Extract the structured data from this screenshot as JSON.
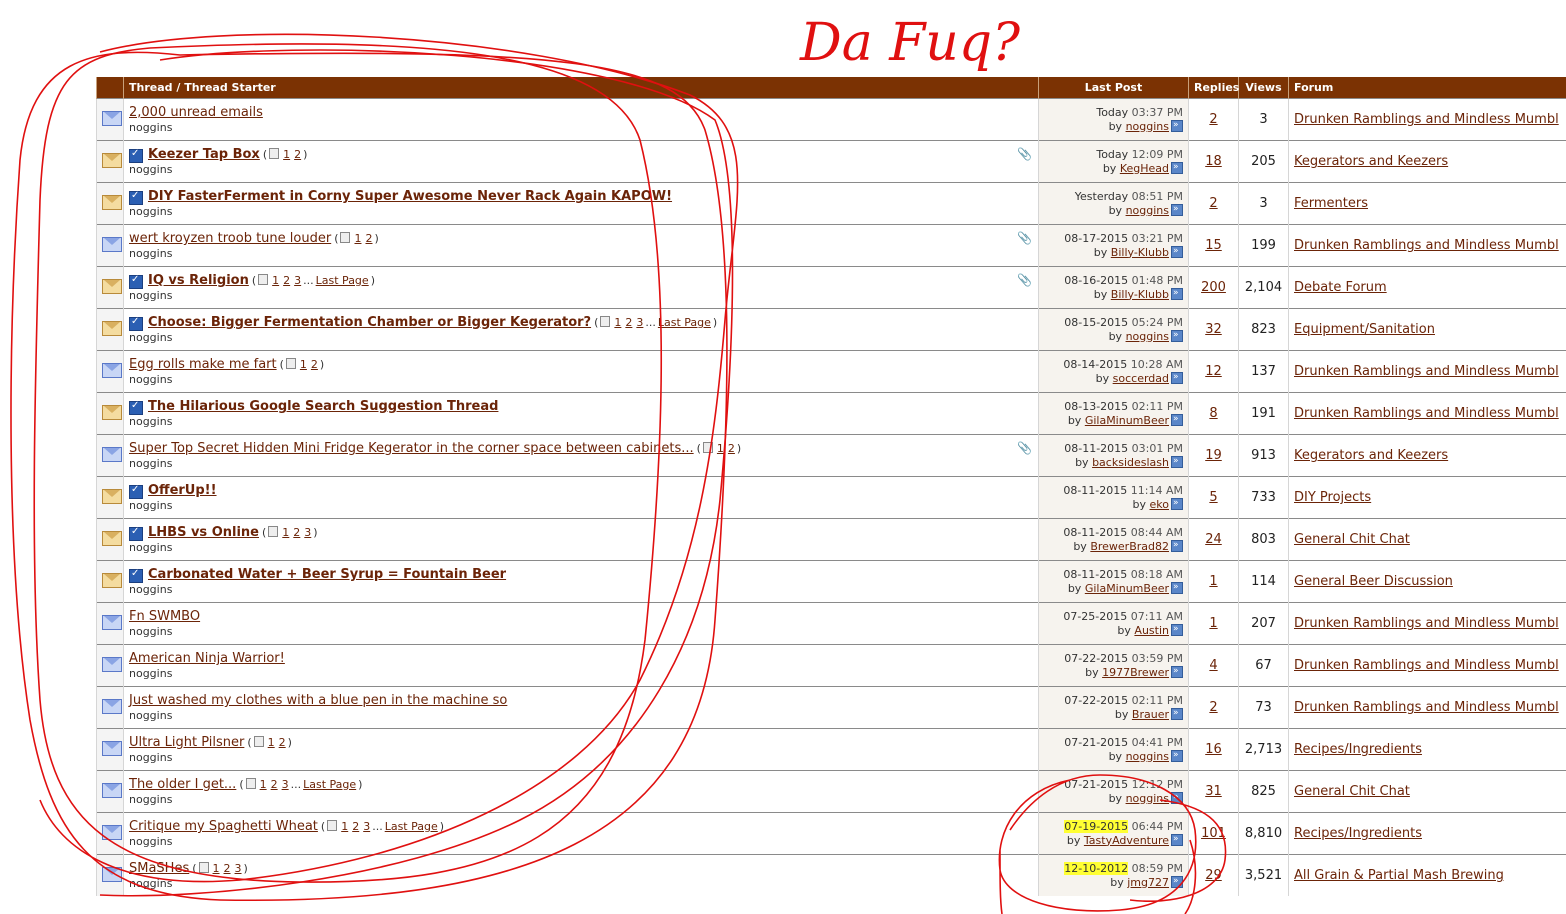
{
  "annotation_text": "Da Fuq?",
  "headers": {
    "thread": "Thread / Thread Starter",
    "last_post": "Last Post",
    "replies": "Replies",
    "views": "Views",
    "forum": "Forum"
  },
  "colors": {
    "header_bg": "#7b3203",
    "link": "#6b2408",
    "highlight": "#ffff33",
    "annotation": "#e01010"
  },
  "threads": [
    {
      "title": "2,000 unread emails",
      "starter": "noggins",
      "bold": false,
      "sub": false,
      "hot": false,
      "pages": [],
      "last_page": false,
      "attach": false,
      "date": "Today",
      "time": "03:37 PM",
      "by": "noggins",
      "replies": "2",
      "views": "3",
      "forum": "Drunken Ramblings and Mindless Mumbl",
      "hl": false
    },
    {
      "title": "Keezer Tap Box",
      "starter": "noggins",
      "bold": true,
      "sub": true,
      "hot": true,
      "pages": [
        "1",
        "2"
      ],
      "last_page": false,
      "attach": true,
      "date": "Today",
      "time": "12:09 PM",
      "by": "KegHead",
      "replies": "18",
      "views": "205",
      "forum": "Kegerators and Keezers",
      "hl": false
    },
    {
      "title": "DIY FasterFerment in Corny Super Awesome Never Rack Again KAPOW!",
      "starter": "noggins",
      "bold": true,
      "sub": true,
      "hot": true,
      "pages": [],
      "last_page": false,
      "attach": false,
      "date": "Yesterday",
      "time": "08:51 PM",
      "by": "noggins",
      "replies": "2",
      "views": "3",
      "forum": "Fermenters",
      "hl": false
    },
    {
      "title": "wert kroyzen troob tune louder",
      "starter": "noggins",
      "bold": false,
      "sub": false,
      "hot": false,
      "pages": [
        "1",
        "2"
      ],
      "last_page": false,
      "attach": true,
      "date": "08-17-2015",
      "time": "03:21 PM",
      "by": "Billy-Klubb",
      "replies": "15",
      "views": "199",
      "forum": "Drunken Ramblings and Mindless Mumbl",
      "hl": false
    },
    {
      "title": "IQ vs Religion",
      "starter": "noggins",
      "bold": true,
      "sub": true,
      "hot": true,
      "pages": [
        "1",
        "2",
        "3"
      ],
      "last_page": true,
      "attach": true,
      "date": "08-16-2015",
      "time": "01:48 PM",
      "by": "Billy-Klubb",
      "replies": "200",
      "views": "2,104",
      "forum": "Debate Forum",
      "hl": false
    },
    {
      "title": "Choose: Bigger Fermentation Chamber or Bigger Kegerator?",
      "starter": "noggins",
      "bold": true,
      "sub": true,
      "hot": true,
      "pages": [
        "1",
        "2",
        "3"
      ],
      "last_page": true,
      "attach": false,
      "date": "08-15-2015",
      "time": "05:24 PM",
      "by": "noggins",
      "replies": "32",
      "views": "823",
      "forum": "Equipment/Sanitation",
      "hl": false
    },
    {
      "title": "Egg rolls make me fart",
      "starter": "noggins",
      "bold": false,
      "sub": false,
      "hot": false,
      "pages": [
        "1",
        "2"
      ],
      "last_page": false,
      "attach": false,
      "date": "08-14-2015",
      "time": "10:28 AM",
      "by": "soccerdad",
      "replies": "12",
      "views": "137",
      "forum": "Drunken Ramblings and Mindless Mumbl",
      "hl": false
    },
    {
      "title": "The Hilarious Google Search Suggestion Thread",
      "starter": "noggins",
      "bold": true,
      "sub": true,
      "hot": true,
      "pages": [],
      "last_page": false,
      "attach": false,
      "date": "08-13-2015",
      "time": "02:11 PM",
      "by": "GilaMinumBeer",
      "replies": "8",
      "views": "191",
      "forum": "Drunken Ramblings and Mindless Mumbl",
      "hl": false
    },
    {
      "title": "Super Top Secret Hidden Mini Fridge Kegerator in the corner space between cabinets...",
      "starter": "noggins",
      "bold": false,
      "sub": false,
      "hot": false,
      "pages": [
        "1",
        "2"
      ],
      "last_page": false,
      "attach": true,
      "date": "08-11-2015",
      "time": "03:01 PM",
      "by": "backsideslash",
      "replies": "19",
      "views": "913",
      "forum": "Kegerators and Keezers",
      "hl": false
    },
    {
      "title": "OfferUp!!",
      "starter": "noggins",
      "bold": true,
      "sub": true,
      "hot": true,
      "pages": [],
      "last_page": false,
      "attach": false,
      "date": "08-11-2015",
      "time": "11:14 AM",
      "by": "eko",
      "replies": "5",
      "views": "733",
      "forum": "DIY Projects",
      "hl": false
    },
    {
      "title": "LHBS vs Online",
      "starter": "noggins",
      "bold": true,
      "sub": true,
      "hot": true,
      "pages": [
        "1",
        "2",
        "3"
      ],
      "last_page": false,
      "attach": false,
      "date": "08-11-2015",
      "time": "08:44 AM",
      "by": "BrewerBrad82",
      "replies": "24",
      "views": "803",
      "forum": "General Chit Chat",
      "hl": false
    },
    {
      "title": "Carbonated Water + Beer Syrup = Fountain Beer",
      "starter": "noggins",
      "bold": true,
      "sub": true,
      "hot": true,
      "pages": [],
      "last_page": false,
      "attach": false,
      "date": "08-11-2015",
      "time": "08:18 AM",
      "by": "GilaMinumBeer",
      "replies": "1",
      "views": "114",
      "forum": "General Beer Discussion",
      "hl": false
    },
    {
      "title": "Fn SWMBO",
      "starter": "noggins",
      "bold": false,
      "sub": false,
      "hot": false,
      "pages": [],
      "last_page": false,
      "attach": false,
      "date": "07-25-2015",
      "time": "07:11 AM",
      "by": "Austin",
      "replies": "1",
      "views": "207",
      "forum": "Drunken Ramblings and Mindless Mumbl",
      "hl": false
    },
    {
      "title": "American Ninja Warrior!",
      "starter": "noggins",
      "bold": false,
      "sub": false,
      "hot": false,
      "pages": [],
      "last_page": false,
      "attach": false,
      "date": "07-22-2015",
      "time": "03:59 PM",
      "by": "1977Brewer",
      "replies": "4",
      "views": "67",
      "forum": "Drunken Ramblings and Mindless Mumbl",
      "hl": false
    },
    {
      "title": "Just washed my clothes with a blue pen in the machine so",
      "starter": "noggins",
      "bold": false,
      "sub": false,
      "hot": false,
      "pages": [],
      "last_page": false,
      "attach": false,
      "date": "07-22-2015",
      "time": "02:11 PM",
      "by": "Brauer",
      "replies": "2",
      "views": "73",
      "forum": "Drunken Ramblings and Mindless Mumbl",
      "hl": false
    },
    {
      "title": "Ultra Light Pilsner",
      "starter": "noggins",
      "bold": false,
      "sub": false,
      "hot": false,
      "pages": [
        "1",
        "2"
      ],
      "last_page": false,
      "attach": false,
      "date": "07-21-2015",
      "time": "04:41 PM",
      "by": "noggins",
      "replies": "16",
      "views": "2,713",
      "forum": "Recipes/Ingredients",
      "hl": false
    },
    {
      "title": "The older I get...",
      "starter": "noggins",
      "bold": false,
      "sub": false,
      "hot": false,
      "pages": [
        "1",
        "2",
        "3"
      ],
      "last_page": true,
      "attach": false,
      "date": "07-21-2015",
      "time": "12:12 PM",
      "by": "noggins",
      "replies": "31",
      "views": "825",
      "forum": "General Chit Chat",
      "hl": false
    },
    {
      "title": "Critique my Spaghetti Wheat",
      "starter": "noggins",
      "bold": false,
      "sub": false,
      "hot": false,
      "pages": [
        "1",
        "2",
        "3"
      ],
      "last_page": true,
      "attach": false,
      "date": "07-19-2015",
      "time": "06:44 PM",
      "by": "TastyAdventure",
      "replies": "101",
      "views": "8,810",
      "forum": "Recipes/Ingredients",
      "hl": true
    },
    {
      "title": "SMaSHes",
      "starter": "noggins",
      "bold": false,
      "sub": false,
      "hot": false,
      "pages": [
        "1",
        "2",
        "3"
      ],
      "last_page": false,
      "attach": false,
      "date": "12-10-2012",
      "time": "08:59 PM",
      "by": "jmg727",
      "replies": "29",
      "views": "3,521",
      "forum": "All Grain & Partial Mash Brewing",
      "hl": true
    }
  ],
  "labels": {
    "by": "by",
    "last_page": "Last Page",
    "ellipsis": "..."
  }
}
